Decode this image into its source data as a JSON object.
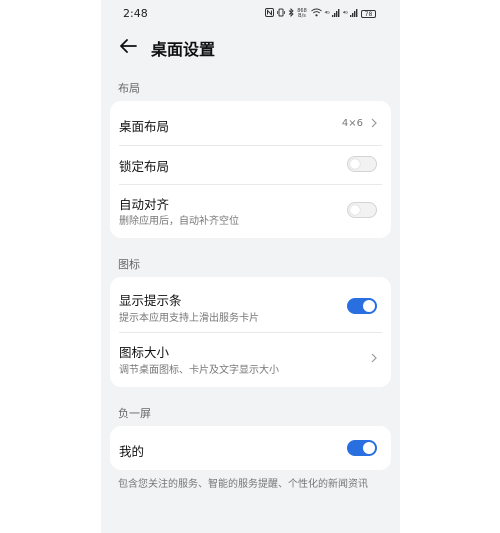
{
  "status": {
    "time": "2:48",
    "network_speed": "868 B/s",
    "battery": "78",
    "signal_1": "⁴ᴳ",
    "signal_2": "⁴ᴳ"
  },
  "header": {
    "title": "桌面设置"
  },
  "sections": [
    {
      "label": "布局",
      "items": [
        {
          "title": "桌面布局",
          "value": "4×6"
        },
        {
          "title": "锁定布局",
          "toggle": false
        },
        {
          "title": "自动对齐",
          "subtitle": "删除应用后，自动补齐空位",
          "toggle": false
        }
      ]
    },
    {
      "label": "图标",
      "items": [
        {
          "title": "显示提示条",
          "subtitle": "提示本应用支持上滑出服务卡片",
          "toggle": true
        },
        {
          "title": "图标大小",
          "subtitle": "调节桌面图标、卡片及文字显示大小"
        }
      ]
    },
    {
      "label": "负一屏",
      "items": [
        {
          "title": "我的",
          "toggle": true
        }
      ]
    }
  ],
  "footnote": "包含您关注的服务、智能的服务提醒、个性化的新闻资讯",
  "colors": {
    "accent": "#2a6fe0",
    "background": "#f1f3f5",
    "card": "#ffffff"
  },
  "icons": {
    "back": "back-arrow-icon",
    "chevron": "chevron-right-icon"
  }
}
